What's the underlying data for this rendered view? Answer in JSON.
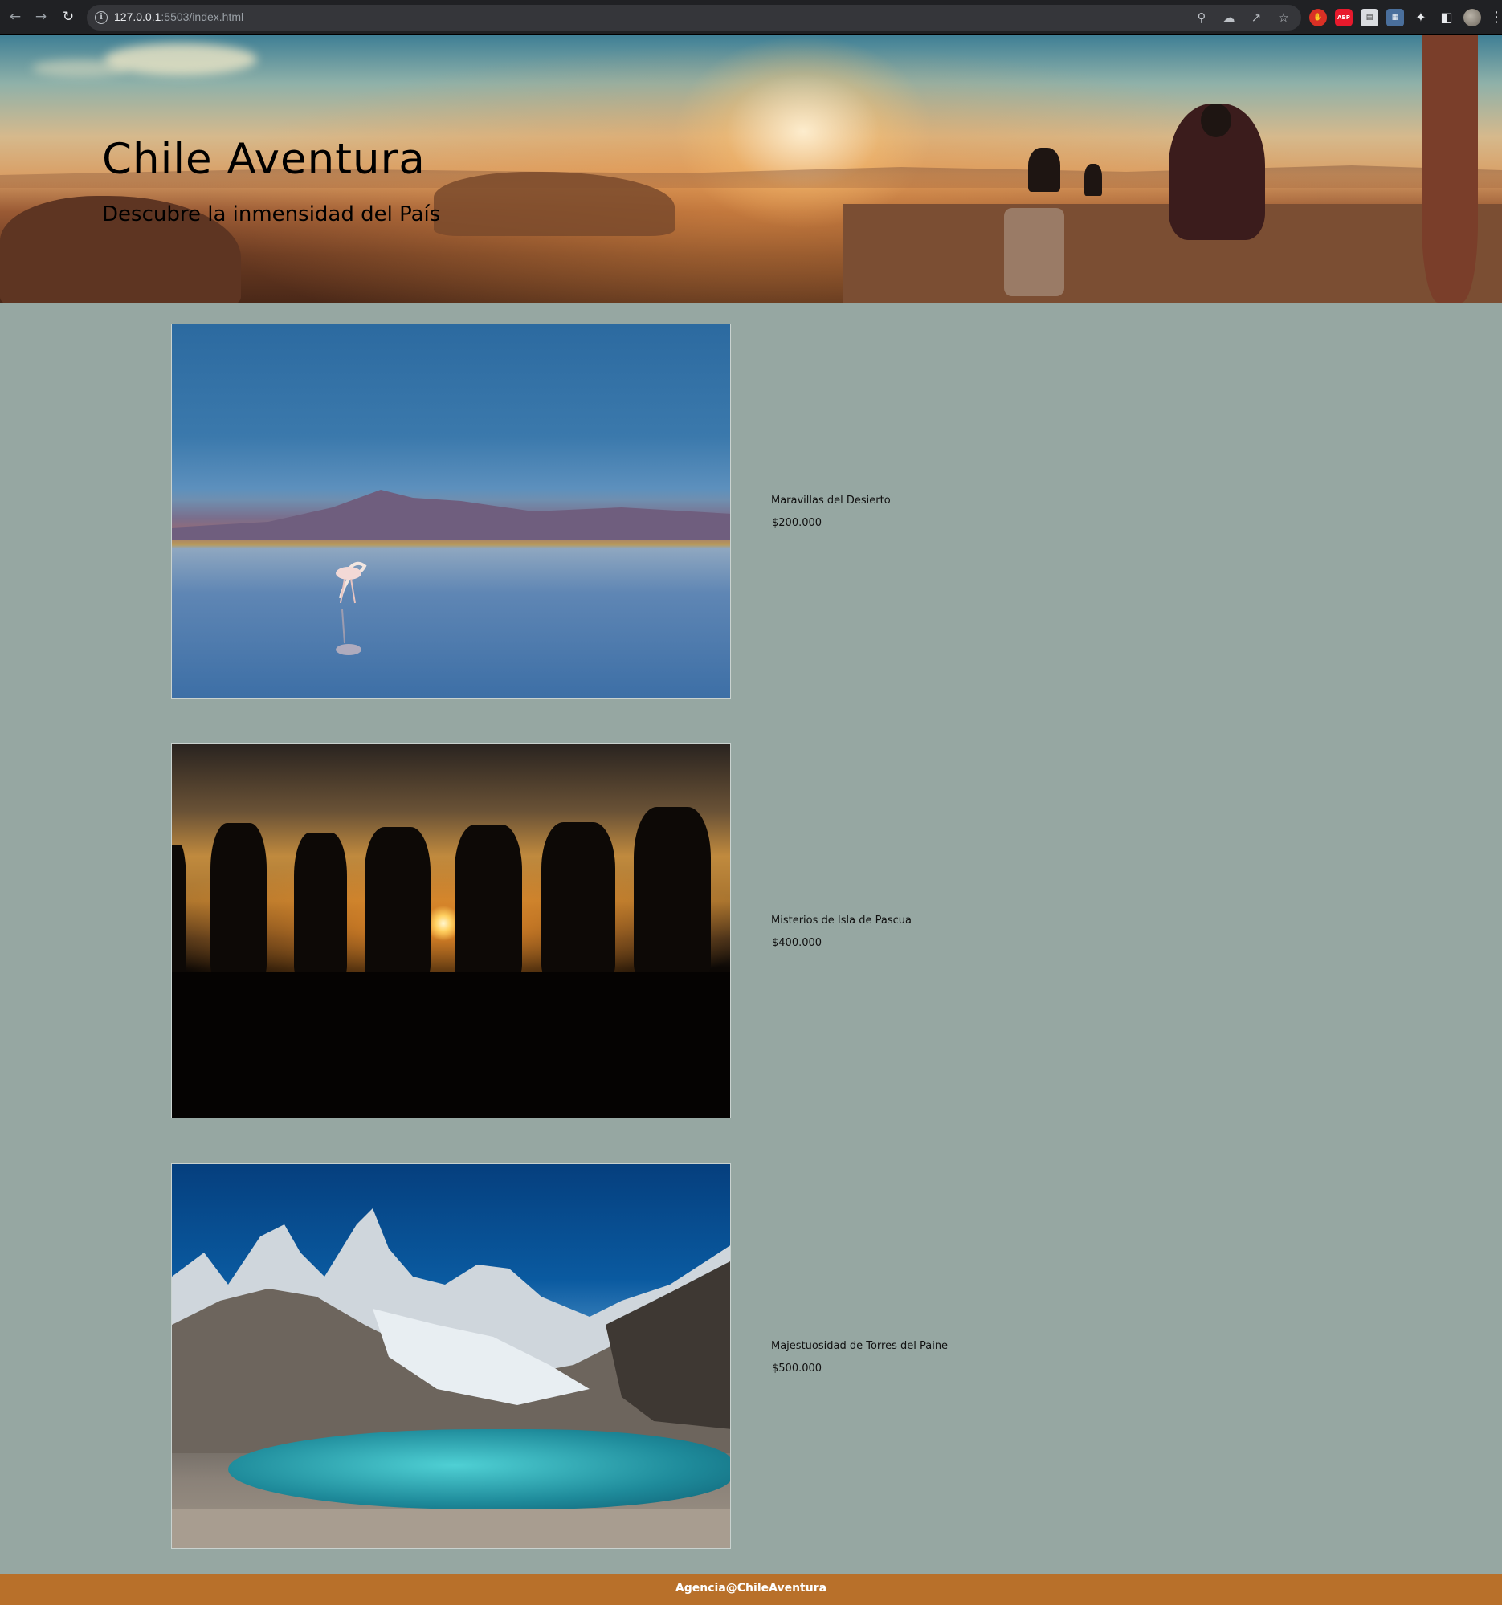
{
  "browser": {
    "url_host": "127.0.0.1",
    "url_rest": ":5503/index.html",
    "extensions": [
      "stop-extension",
      "abp",
      "calendar-extension",
      "blue-extension",
      "puzzle",
      "side-panel"
    ],
    "abp_label": "ABP"
  },
  "hero": {
    "title": "Chile Aventura",
    "subtitle": "Descubre la inmensidad del País"
  },
  "tours": [
    {
      "name": "Maravillas del Desierto",
      "price": "$200.000",
      "image": "flamingo-salt-lake"
    },
    {
      "name": "Misterios de Isla de Pascua",
      "price": "$400.000",
      "image": "moai-sunset"
    },
    {
      "name": "Majestuosidad de Torres del Paine",
      "price": "$500.000",
      "image": "patagonia-mountains-lake"
    }
  ],
  "footer": {
    "text": "Agencia@ChileAventura"
  },
  "colors": {
    "page_bg": "#96a7a2",
    "footer_bg": "#b8702a"
  }
}
